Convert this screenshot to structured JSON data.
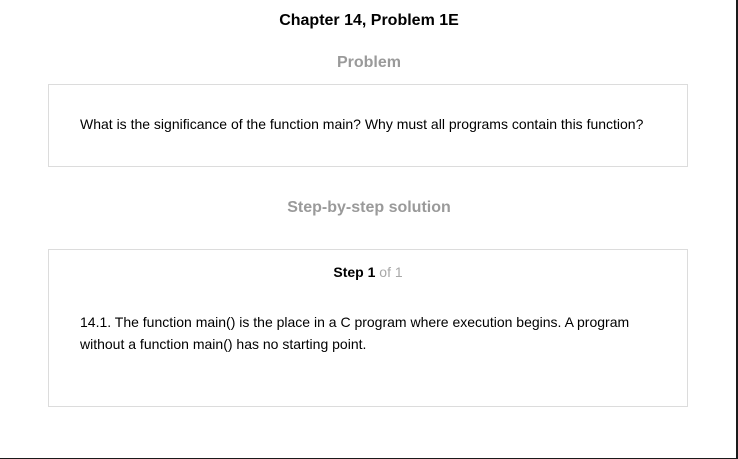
{
  "chapter_title": "Chapter 14, Problem 1E",
  "problem": {
    "heading": "Problem",
    "text": "What is the significance of the function main? Why must all programs contain this function?"
  },
  "solution": {
    "heading": "Step-by-step solution",
    "step": {
      "label": "Step",
      "number": "1",
      "of_text": "of 1"
    },
    "text": "14.1. The function main() is the place in a C program where execution begins. A program without a function main() has no starting point."
  }
}
